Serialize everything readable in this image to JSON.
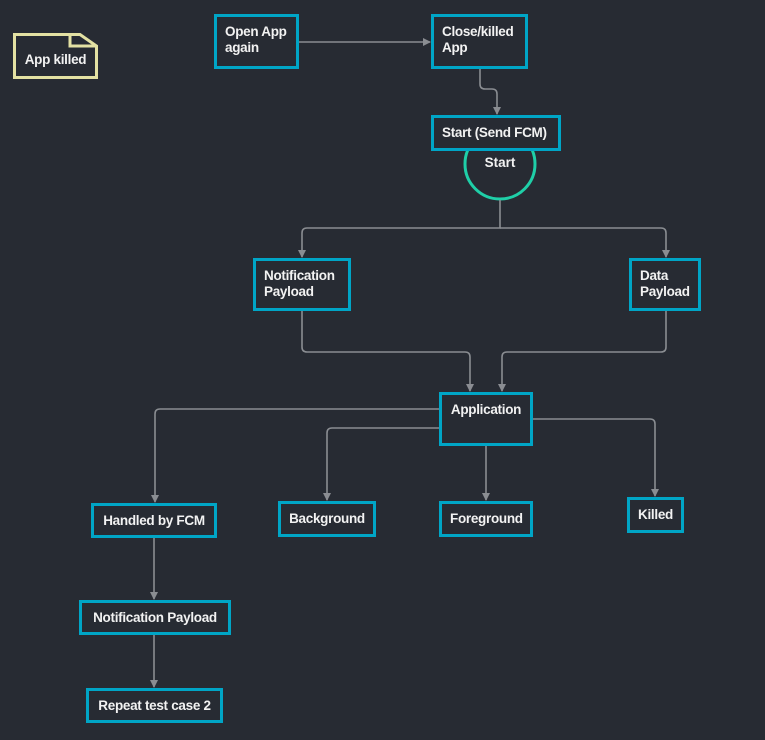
{
  "colors": {
    "background": "#272b33",
    "node_border": "#00a5c6",
    "start_circle": "#1fcfa8",
    "note_border": "#e3e1a3",
    "connector": "#8a8d92",
    "text": "#f2f2f2"
  },
  "note": {
    "label": "App killed"
  },
  "nodes": {
    "open": "Open App again",
    "close": "Close/killed App",
    "startfcm": "Start (Send FCM)",
    "start_circle": "Start",
    "notif": "Notification Payload",
    "data": "Data Payload",
    "app": "Application",
    "handled": "Handled by FCM",
    "background": "Background",
    "foreground": "Foreground",
    "killed": "Killed",
    "notif2": "Notification Payload",
    "repeat": "Repeat test case 2"
  },
  "edges": [
    [
      "open",
      "close"
    ],
    [
      "close",
      "startfcm"
    ],
    [
      "start_circle",
      "notif"
    ],
    [
      "start_circle",
      "data"
    ],
    [
      "notif",
      "app"
    ],
    [
      "data",
      "app"
    ],
    [
      "app",
      "handled"
    ],
    [
      "app",
      "background"
    ],
    [
      "app",
      "foreground"
    ],
    [
      "app",
      "killed"
    ],
    [
      "handled",
      "notif2"
    ],
    [
      "notif2",
      "repeat"
    ]
  ]
}
